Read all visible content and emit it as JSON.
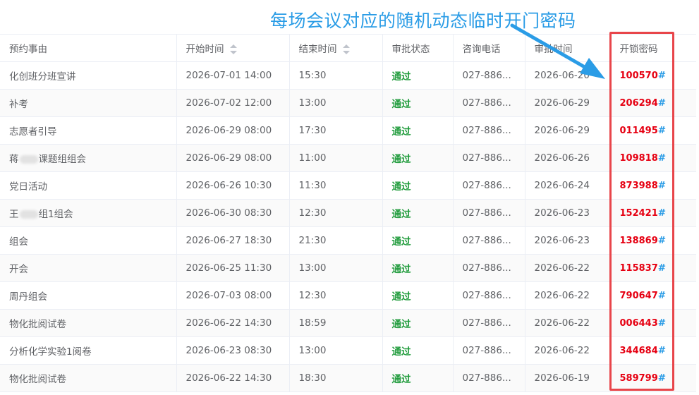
{
  "annotation": {
    "text": "每场会议对应的随机动态临时开门密码",
    "color": "#2a9ce6",
    "box_color": "#e8454a"
  },
  "table": {
    "headers": [
      "预约事由",
      "开始时间",
      "结束时间",
      "审批状态",
      "咨询电话",
      "审批时间",
      "开锁密码"
    ],
    "sortable_columns": [
      "开始时间",
      "结束时间"
    ],
    "status_color": "#1f9b3b",
    "password_color": "#e60012",
    "rows": [
      {
        "reason": "化创班分班宣讲",
        "start": "2026-07-01 14:00",
        "end": "15:30",
        "status": "通过",
        "phone": "027-886...",
        "approved": "2026-06-20",
        "password": "100570",
        "suffix": "#"
      },
      {
        "reason": "补考",
        "start": "2026-07-02 12:00",
        "end": "13:00",
        "status": "通过",
        "phone": "027-886...",
        "approved": "2026-06-29",
        "password": "206294",
        "suffix": "#"
      },
      {
        "reason": "志愿者引导",
        "start": "2026-06-29 08:00",
        "end": "17:30",
        "status": "通过",
        "phone": "027-886...",
        "approved": "2026-06-29",
        "password": "011495",
        "suffix": "#"
      },
      {
        "reason_pre": "蒋",
        "reason_post": "课题组组会",
        "start": "2026-06-29 08:00",
        "end": "11:00",
        "status": "通过",
        "phone": "027-886...",
        "approved": "2026-06-26",
        "password": "109818",
        "suffix": "#"
      },
      {
        "reason": "党日活动",
        "start": "2026-06-26 10:30",
        "end": "11:30",
        "status": "通过",
        "phone": "027-886...",
        "approved": "2026-06-24",
        "password": "873988",
        "suffix": "#"
      },
      {
        "reason_pre": "王",
        "reason_post": "组1组会",
        "start": "2026-06-30 08:30",
        "end": "12:30",
        "status": "通过",
        "phone": "027-886...",
        "approved": "2026-06-23",
        "password": "152421",
        "suffix": "#"
      },
      {
        "reason": "组会",
        "start": "2026-06-27 18:30",
        "end": "21:30",
        "status": "通过",
        "phone": "027-886...",
        "approved": "2026-06-23",
        "password": "138869",
        "suffix": "#"
      },
      {
        "reason": "开会",
        "start": "2026-06-25 11:30",
        "end": "13:00",
        "status": "通过",
        "phone": "027-886...",
        "approved": "2026-06-22",
        "password": "115837",
        "suffix": "#"
      },
      {
        "reason": "周丹组会",
        "start": "2026-07-03 08:00",
        "end": "12:30",
        "status": "通过",
        "phone": "027-886...",
        "approved": "2026-06-22",
        "password": "790647",
        "suffix": "#"
      },
      {
        "reason": "物化批阅试卷",
        "start": "2026-06-22 14:30",
        "end": "18:59",
        "status": "通过",
        "phone": "027-886...",
        "approved": "2026-06-22",
        "password": "006443",
        "suffix": "#"
      },
      {
        "reason": "分析化学实验1阅卷",
        "start": "2026-06-23 08:30",
        "end": "13:00",
        "status": "通过",
        "phone": "027-886...",
        "approved": "2026-06-22",
        "password": "344684",
        "suffix": "#"
      },
      {
        "reason": "物化批阅试卷",
        "start": "2026-06-22 14:30",
        "end": "18:30",
        "status": "通过",
        "phone": "027-886...",
        "approved": "2026-06-19",
        "password": "589799",
        "suffix": "#"
      }
    ]
  }
}
